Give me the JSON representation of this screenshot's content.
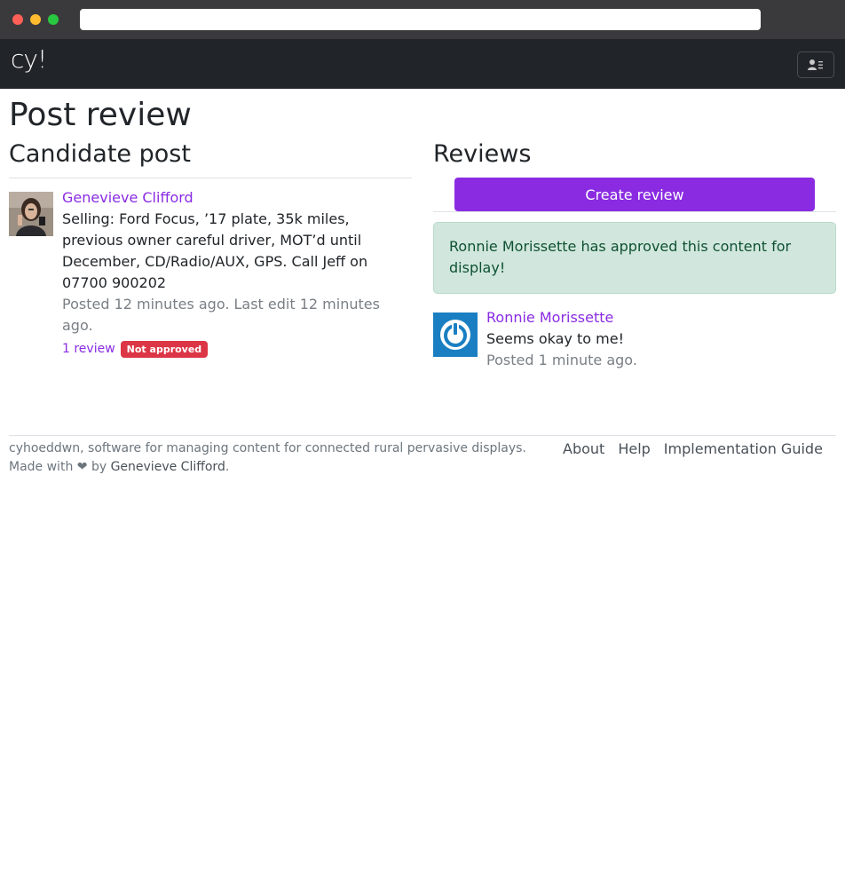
{
  "app": {
    "brand": "cy!"
  },
  "page": {
    "title": "Post review"
  },
  "candidate": {
    "heading": "Candidate post",
    "author": "Genevieve Clifford",
    "text": "Selling: Ford Focus, ’17 plate, 35k miles, previous owner careful driver, MOT’d until December, CD/Radio/AUX, GPS. Call Jeff on 07700 900202",
    "posted": "Posted 12 minutes ago. Last edit 12 minutes ago.",
    "review_count": "1 review",
    "status_badge": "Not approved"
  },
  "reviews": {
    "heading": "Reviews",
    "create_label": "Create review",
    "alert": "Ronnie Morissette has approved this content for display!",
    "items": [
      {
        "author": "Ronnie Morissette",
        "text": "Seems okay to me!",
        "posted": "Posted 1 minute ago."
      }
    ]
  },
  "footer": {
    "description": "cyhoeddwn, software for managing content for connected rural pervasive displays.",
    "made_with_prefix": "Made with ❤ by",
    "made_with_author": "Genevieve Clifford",
    "made_with_suffix": ".",
    "links": [
      "About",
      "Help",
      "Implementation Guide"
    ]
  },
  "colors": {
    "accent": "#8a2be2",
    "navbar": "#212529",
    "danger": "#dc3545",
    "success_bg": "#d1e7dd"
  },
  "icons": {
    "nav_toggle": "user-menu-icon",
    "review_avatar": "power-icon"
  }
}
